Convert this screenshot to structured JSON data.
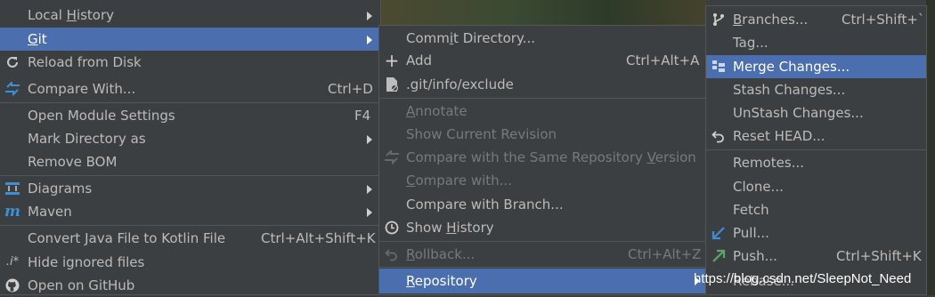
{
  "menu1": {
    "local_history": "Local History",
    "git": "Git",
    "reload": "Reload from Disk",
    "compare_with": "Compare With...",
    "compare_with_sc": "Ctrl+D",
    "open_module": "Open Module Settings",
    "open_module_sc": "F4",
    "mark_dir": "Mark Directory as",
    "remove_bom": "Remove BOM",
    "diagrams": "Diagrams",
    "maven": "Maven",
    "convert_kotlin": "Convert Java File to Kotlin File",
    "convert_kotlin_sc": "Ctrl+Alt+Shift+K",
    "hide_ignored": "Hide ignored files",
    "open_github": "Open on GitHub"
  },
  "menu2": {
    "commit_dir": "Commit Directory...",
    "add": "Add",
    "add_sc": "Ctrl+Alt+A",
    "git_exclude": ".git/info/exclude",
    "annotate": "Annotate",
    "show_current": "Show Current Revision",
    "compare_same_repo": "Compare with the Same Repository Version",
    "compare_with": "Compare with...",
    "compare_branch": "Compare with Branch...",
    "show_history": "Show History",
    "rollback": "Rollback...",
    "rollback_sc": "Ctrl+Alt+Z",
    "repository": "Repository"
  },
  "menu3": {
    "branches": "Branches...",
    "branches_sc": "Ctrl+Shift+`",
    "tag": "Tag...",
    "merge_changes": "Merge Changes...",
    "stash": "Stash Changes...",
    "unstash": "UnStash Changes...",
    "reset_head": "Reset HEAD...",
    "remotes": "Remotes...",
    "clone": "Clone...",
    "fetch": "Fetch",
    "pull": "Pull...",
    "push": "Push...",
    "push_sc": "Ctrl+Shift+K",
    "rebase": "Rebase..."
  },
  "watermark": "https://blog.csdn.net/SleepNot_Need",
  "colors": {
    "menu_bg": "#3c3f41",
    "selection": "#4b6eaf",
    "text": "#bbbbbb",
    "disabled": "#77797b"
  }
}
